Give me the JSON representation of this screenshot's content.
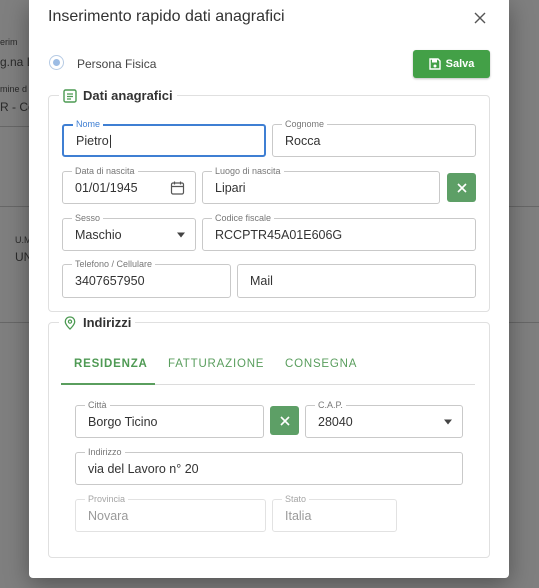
{
  "background": {
    "fragments": [
      "erim",
      "g.na L",
      "mine d",
      "R - Co",
      "U.M",
      "UN"
    ]
  },
  "dialog": {
    "title": "Inserimento rapido dati anagrafici",
    "radio_label": "Persona Fisica",
    "save_label": "Salva",
    "anagrafici": {
      "legend": "Dati anagrafici",
      "nome": {
        "label": "Nome",
        "value": "Pietro"
      },
      "cognome": {
        "label": "Cognome",
        "value": "Rocca"
      },
      "data_nascita": {
        "label": "Data di nascita",
        "value": "01/01/1945"
      },
      "luogo_nascita": {
        "label": "Luogo di nascita",
        "value": "Lipari"
      },
      "sesso": {
        "label": "Sesso",
        "value": "Maschio"
      },
      "codice_fiscale": {
        "label": "Codice fiscale",
        "value": "RCCPTR45A01E606G"
      },
      "telefono": {
        "label": "Telefono / Cellulare",
        "value": "3407657950"
      },
      "mail": {
        "placeholder": "Mail"
      }
    },
    "indirizzi": {
      "legend": "Indirizzi",
      "tabs": [
        "RESIDENZA",
        "FATTURAZIONE",
        "CONSEGNA"
      ],
      "active_tab": "RESIDENZA",
      "citta": {
        "label": "Città",
        "value": "Borgo Ticino"
      },
      "cap": {
        "label": "C.A.P.",
        "value": "28040"
      },
      "indirizzo": {
        "label": "Indirizzo",
        "value": "via del Lavoro n° 20"
      },
      "provincia": {
        "label": "Provincia",
        "value": "Novara"
      },
      "stato": {
        "label": "Stato",
        "value": "Italia"
      }
    }
  },
  "colors": {
    "accent_green": "#43a047",
    "focus_blue": "#3f7fd3",
    "tab_green": "#5a9e5e"
  },
  "icons": [
    "close-icon",
    "save-icon",
    "list-icon",
    "location-pin-icon",
    "calendar-icon",
    "clear-icon",
    "chevron-down-icon"
  ]
}
